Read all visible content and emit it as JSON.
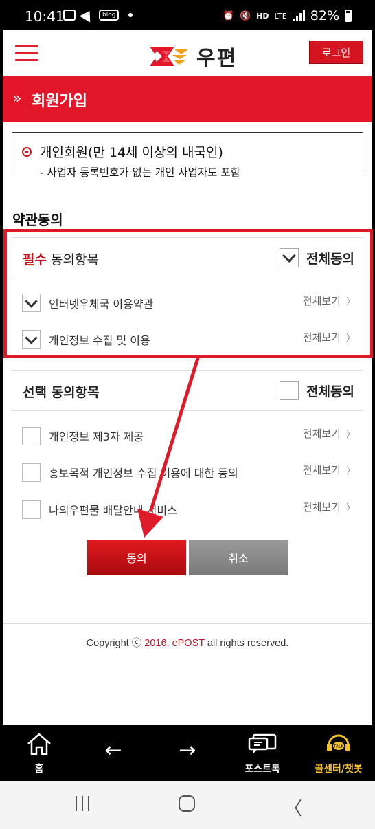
{
  "status_bar": {
    "time": "10:41",
    "blog_label": "blog",
    "hd_label": "HD",
    "lte_label": "LTE",
    "battery": "82%"
  },
  "header": {
    "logo_text": "우편",
    "login_label": "로그인"
  },
  "title_bar": {
    "chevron": "»",
    "title": "회원가입"
  },
  "member_type": {
    "title": "개인회원(만 14세 이상의 내국인)",
    "subtitle": "- 사업자 등록번호가 없는 개인 사업자도 포함"
  },
  "agreement": {
    "heading": "약관동의",
    "required": {
      "title_prefix": "필수",
      "title_suffix": " 동의항목",
      "all_label": "전체동의",
      "all_checked": true,
      "items": [
        {
          "label": "인터넷우체국 이용약관",
          "view": "전체보기",
          "checked": true
        },
        {
          "label": "개인정보 수집 및 이용",
          "view": "전체보기",
          "checked": true
        }
      ]
    },
    "optional": {
      "title": "선택 동의항목",
      "all_label": "전체동의",
      "all_checked": false,
      "items": [
        {
          "label": "개인정보 제3자 제공",
          "view": "전체보기",
          "checked": false
        },
        {
          "label": "홍보목적 개인정보 수집 이용에 대한 동의",
          "view": "전체보기",
          "checked": false
        },
        {
          "label": "나의우편물 배달안내 서비스",
          "view": "전체보기",
          "checked": false
        }
      ]
    }
  },
  "buttons": {
    "agree": "동의",
    "cancel": "취소"
  },
  "footer": {
    "copyright_prefix": "Copyright ⓒ ",
    "copyright_year": "2016. ePOST",
    "copyright_suffix": " all rights reserved."
  },
  "app_nav": {
    "home": "홈",
    "back": "←",
    "forward": "→",
    "posttalk": "포스트톡",
    "callcenter": "콜센터/챗봇"
  },
  "colors": {
    "brand_red": "#e3172a",
    "highlight_red": "#e01b29",
    "callcenter_yellow": "#f2c12e"
  }
}
